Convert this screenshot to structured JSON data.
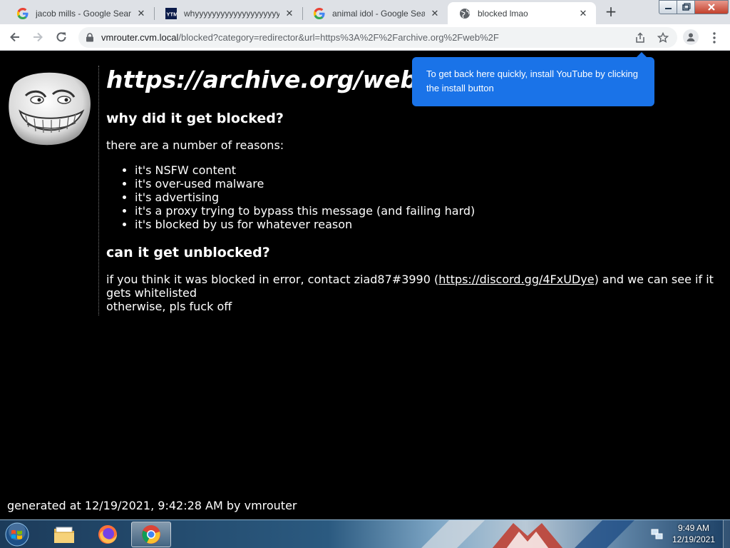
{
  "browser": {
    "tabs": [
      {
        "title": "jacob mills - Google Search",
        "icon": "google-g-icon",
        "active": false
      },
      {
        "title": "whyyyyyyyyyyyyyyyyyyyyyyyyyyyyyyy",
        "icon": "youtube-music-icon",
        "active": false
      },
      {
        "title": "animal idol - Google Search",
        "icon": "google-g-icon",
        "active": false
      },
      {
        "title": "blocked lmao",
        "icon": "globe-icon",
        "active": true
      }
    ],
    "url": {
      "host": "vmrouter.cvm.local",
      "path": "/blocked?category=redirector&url=https%3A%2F%2Farchive.org%2Fweb%2F"
    }
  },
  "install_bubble": {
    "text": "To get back here quickly, install YouTube by clicking the install button"
  },
  "page": {
    "heading": "https://archive.org/web/",
    "why_heading": "why did it get blocked?",
    "reasons_intro": "there are a number of reasons:",
    "reasons": [
      "it's NSFW content",
      "it's over-used malware",
      "it's advertising",
      "it's a proxy trying to bypass this message (and failing hard)",
      "it's blocked by us for whatever reason"
    ],
    "unblock_heading": "can it get unblocked?",
    "contact_before": "if you think it was blocked in error, contact ziad87#3990 (",
    "contact_link": "https://discord.gg/4FxUDye",
    "contact_after": ") and we can see if it gets whitelisted",
    "contact_line2": "otherwise, pls fuck off",
    "footer": "generated at 12/19/2021, 9:42:28 AM by vmrouter"
  },
  "taskbar": {
    "apps": [
      {
        "name": "explorer",
        "icon": "folder-icon",
        "active": false
      },
      {
        "name": "firefox",
        "icon": "firefox-icon",
        "active": false
      },
      {
        "name": "chrome",
        "icon": "chrome-icon",
        "active": true
      }
    ],
    "clock_time": "9:49 AM",
    "clock_date": "12/19/2021"
  },
  "colors": {
    "page_bg": "#000000",
    "bubble_bg": "#1a73e8",
    "tabstrip_bg": "#dee1e6"
  }
}
